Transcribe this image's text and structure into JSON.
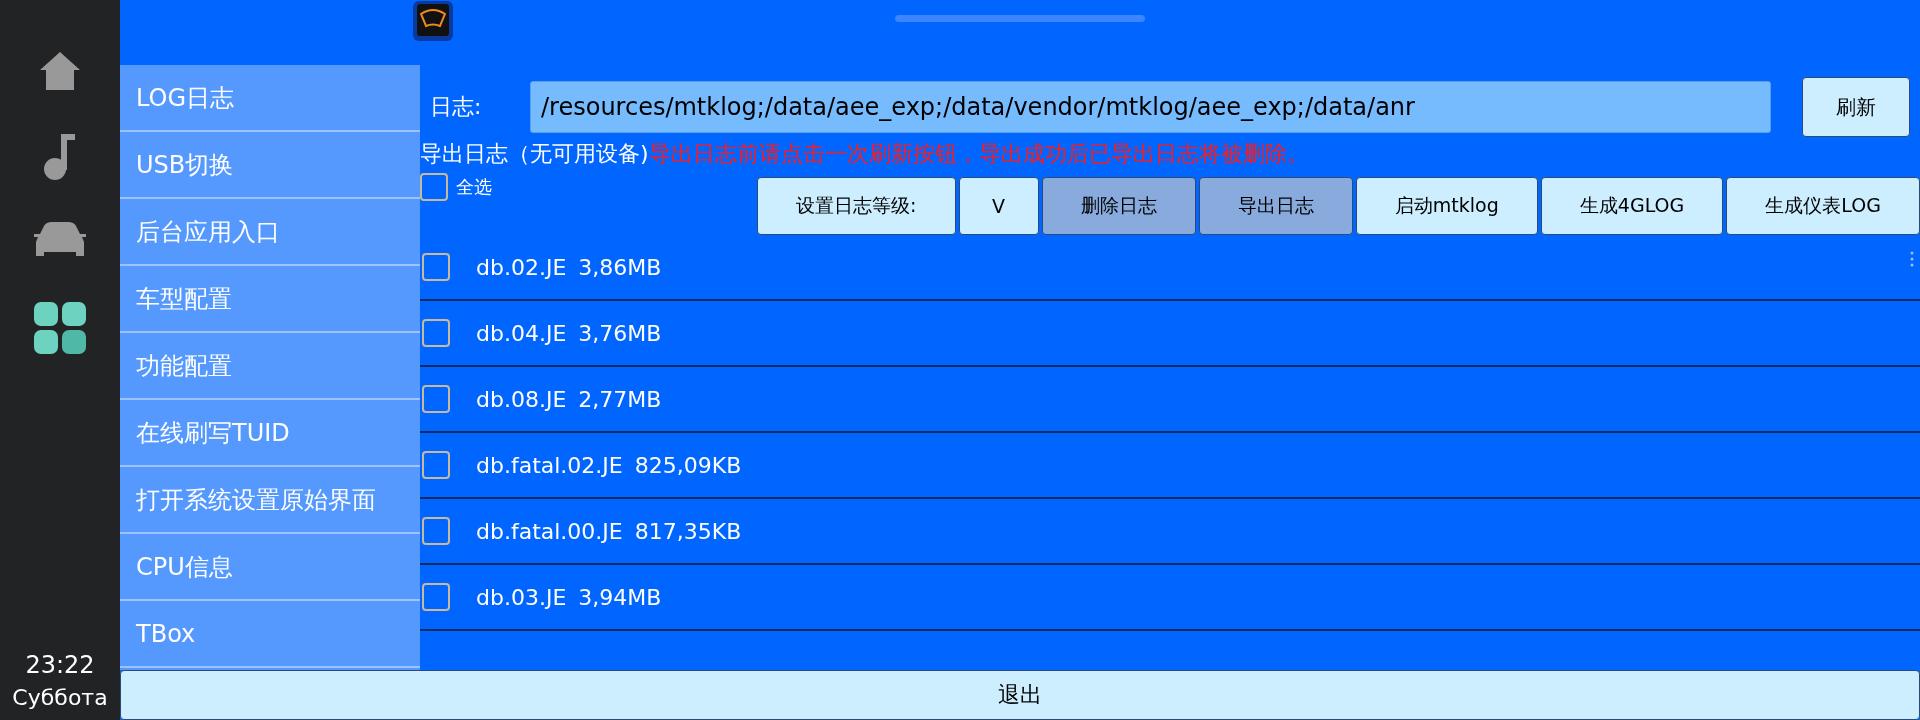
{
  "dock": {
    "time": "23:22",
    "day": "Суббота"
  },
  "menu": {
    "items": [
      {
        "label": "LOG日志"
      },
      {
        "label": "USB切换"
      },
      {
        "label": "后台应用入口"
      },
      {
        "label": "车型配置"
      },
      {
        "label": "功能配置"
      },
      {
        "label": "在线刷写TUID"
      },
      {
        "label": "打开系统设置原始界面"
      },
      {
        "label": "CPU信息"
      },
      {
        "label": "TBox"
      }
    ]
  },
  "log_path": {
    "label": "日志:",
    "value": "/resources/mtklog;/data/aee_exp;/data/vendor/mtklog/aee_exp;/data/anr"
  },
  "refresh_button": "刷新",
  "export": {
    "status": "导出日志（无可用设备)",
    "warning": "导出日志前请点击一次刷新按钮，导出成功后已导出日志将被删除。"
  },
  "select_all": {
    "label": "全选",
    "checked": false
  },
  "actions": [
    {
      "label": "设置日志等级:",
      "disabled": false
    },
    {
      "label": "V",
      "disabled": false
    },
    {
      "label": "删除日志",
      "disabled": true
    },
    {
      "label": "导出日志",
      "disabled": true
    },
    {
      "label": "启动mtklog",
      "disabled": false
    },
    {
      "label": "生成4GLOG",
      "disabled": false
    },
    {
      "label": "生成仪表LOG",
      "disabled": false
    }
  ],
  "files": [
    {
      "name": "db.02.JE",
      "size": "3,86MB",
      "checked": false
    },
    {
      "name": "db.04.JE",
      "size": "3,76MB",
      "checked": false
    },
    {
      "name": "db.08.JE",
      "size": "2,77MB",
      "checked": false
    },
    {
      "name": "db.fatal.02.JE",
      "size": "825,09KB",
      "checked": false
    },
    {
      "name": "db.fatal.00.JE",
      "size": "817,35KB",
      "checked": false
    },
    {
      "name": "db.03.JE",
      "size": "3,94MB",
      "checked": false
    }
  ],
  "exit_button": "退出"
}
